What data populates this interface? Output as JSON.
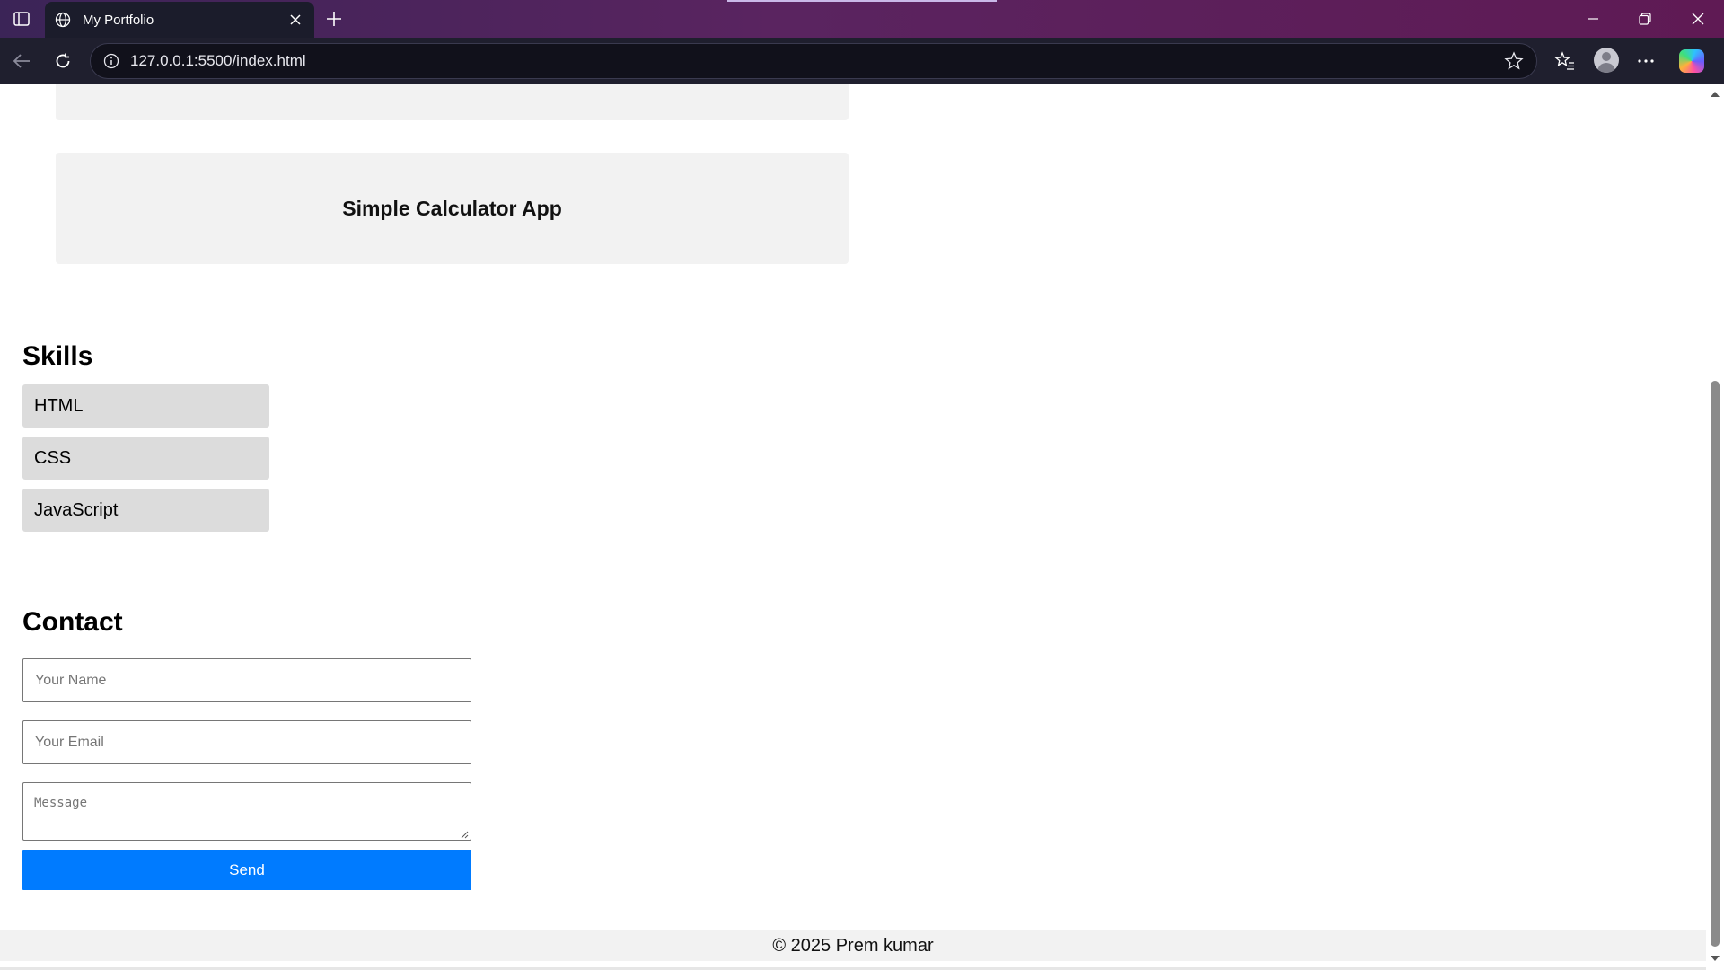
{
  "browser": {
    "tab_title": "My Portfolio",
    "url": "127.0.0.1:5500/index.html",
    "colors": {
      "frame": "#5a2460",
      "toolbar": "#1f1f2e",
      "tab": "#1b1c2b"
    }
  },
  "projects": [
    {
      "title": ""
    },
    {
      "title": "Simple Calculator App"
    }
  ],
  "skills": {
    "heading": "Skills",
    "items": [
      "HTML",
      "CSS",
      "JavaScript"
    ]
  },
  "contact": {
    "heading": "Contact",
    "name_placeholder": "Your Name",
    "email_placeholder": "Your Email",
    "message_placeholder": "Message",
    "send_label": "Send",
    "button_color": "#007bff"
  },
  "footer": {
    "text": "© 2025 Prem kumar"
  }
}
